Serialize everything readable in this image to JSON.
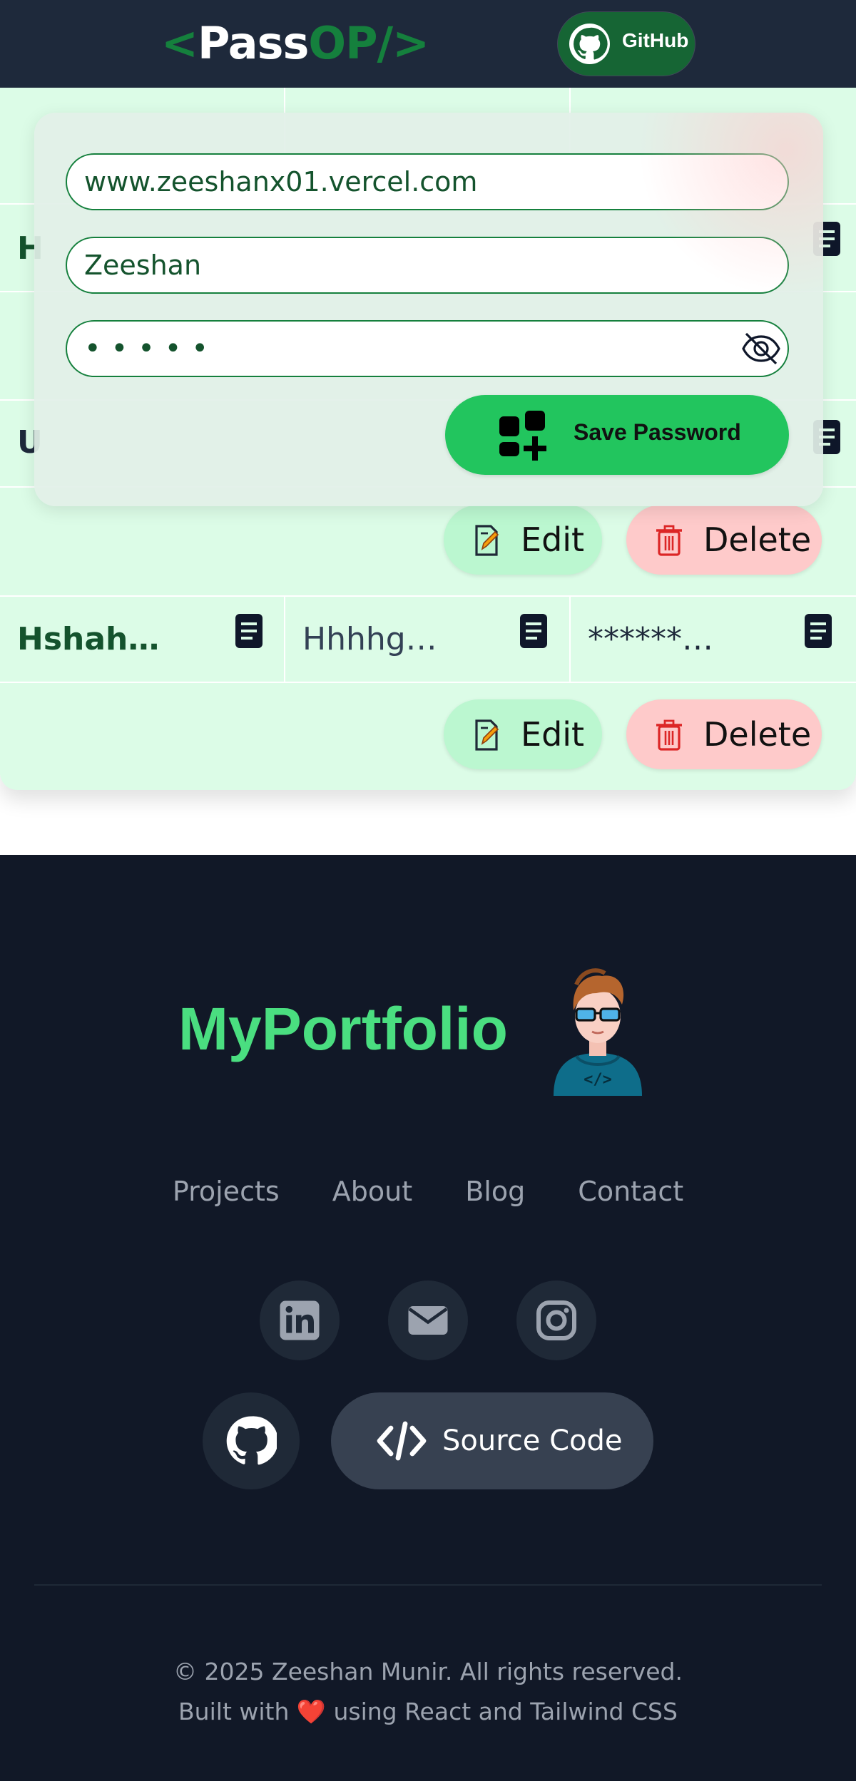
{
  "navbar": {
    "logo": {
      "open": "<",
      "pass": "Pass",
      "op": "OP",
      "close": "/>"
    },
    "github_label": "GitHub"
  },
  "form": {
    "site_value": "www.zeeshanx01.vercel.com",
    "username_value": "Zeeshan",
    "password_masked": "•••••",
    "save_label": "Save Password"
  },
  "table": {
    "partial_rows": [
      {
        "site_initial": "H"
      },
      {
        "site_initial": "U"
      }
    ],
    "rows": [
      {
        "site": "Hshah…",
        "username": "Hhhhg…",
        "password": "******…"
      }
    ],
    "edit_label": "Edit",
    "delete_label": "Delete"
  },
  "footer": {
    "brand": "MyPortfolio",
    "links": [
      "Projects",
      "About",
      "Blog",
      "Contact"
    ],
    "social_icons": [
      "linkedin-icon",
      "mail-icon",
      "instagram-icon"
    ],
    "github_icon": "github-icon",
    "source_code_label": "Source Code",
    "copyright": "© 2025 Zeeshan Munir. All rights reserved.",
    "built_with_prefix": "Built with",
    "heart": "❤️",
    "built_with_suffix": "using React and Tailwind CSS"
  },
  "colors": {
    "navbar_bg": "#1e293b",
    "accent_green": "#22c55e",
    "logo_green": "#15803d",
    "table_bg": "#dcfce7",
    "edit_bg": "#bbf7d0",
    "delete_bg": "#fecaca",
    "footer_bg": "#111827",
    "brand_green": "#4ade80"
  }
}
